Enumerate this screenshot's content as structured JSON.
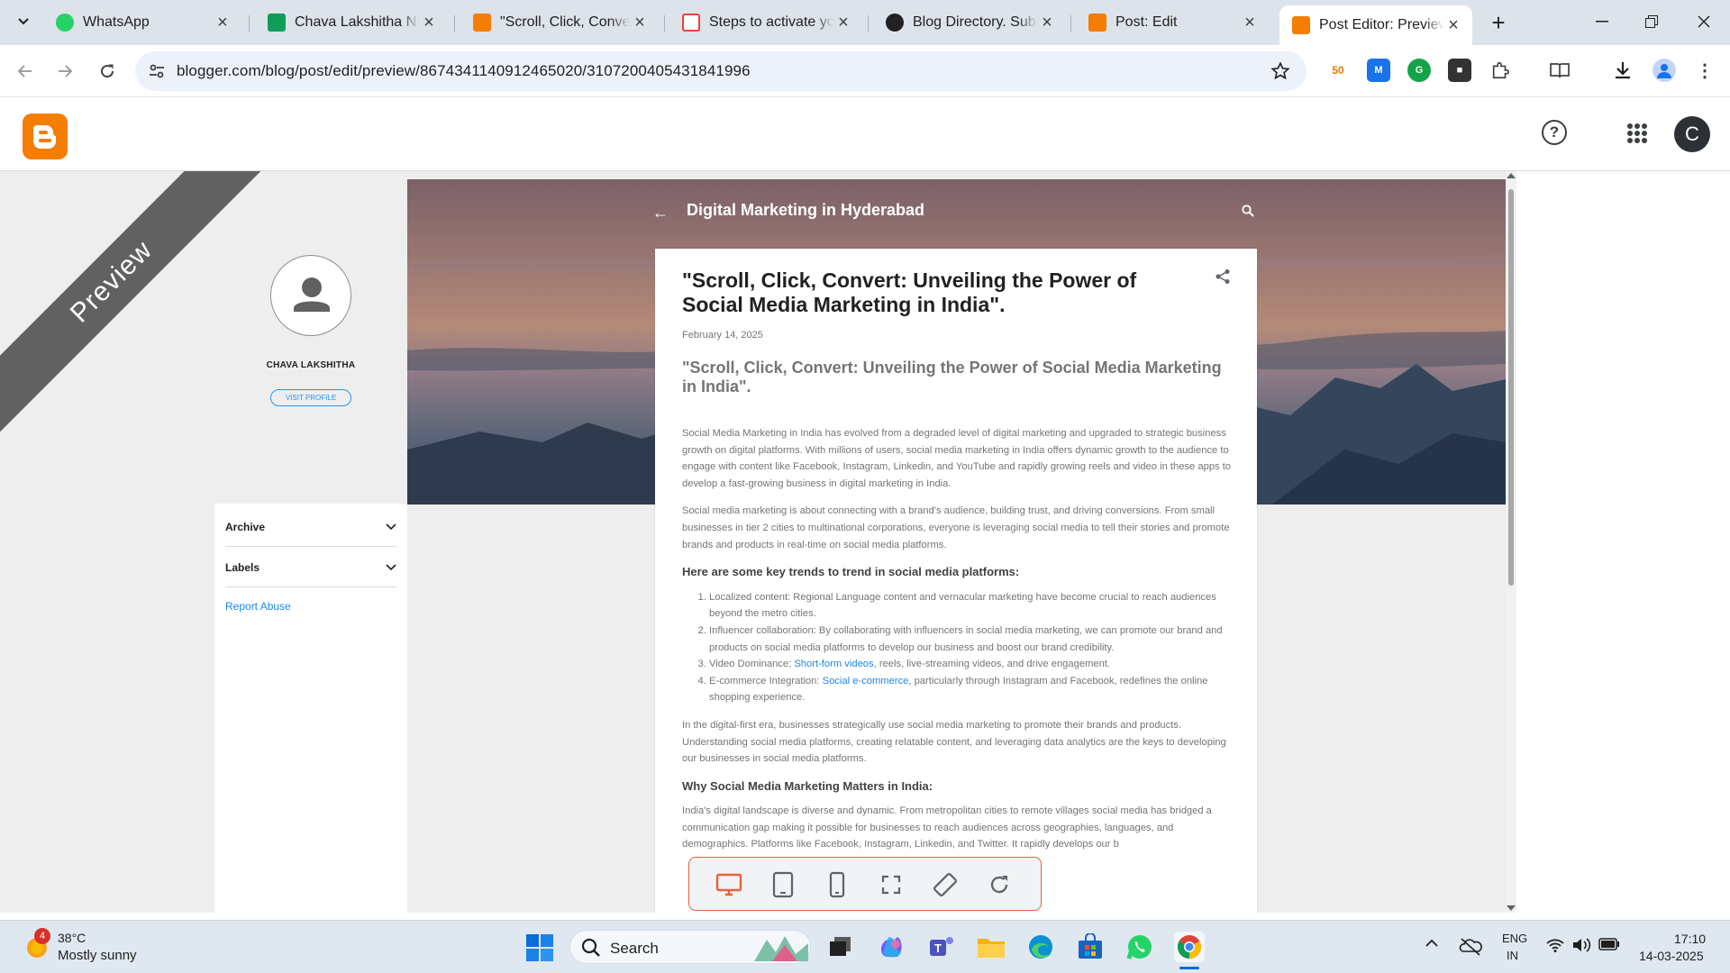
{
  "browser": {
    "tabs": [
      {
        "title": "WhatsApp",
        "icon": "whatsapp-icon"
      },
      {
        "title": "Chava Lakshitha NIDM",
        "icon": "google-sheets-icon"
      },
      {
        "title": "\"Scroll, Click, Convert",
        "icon": "blogger-icon"
      },
      {
        "title": "Steps to activate your",
        "icon": "gmail-icon"
      },
      {
        "title": "Blog Directory. Submit",
        "icon": "blog-directory-icon"
      },
      {
        "title": "Post: Edit",
        "icon": "blogger-icon"
      },
      {
        "title": "Post Editor: Preview",
        "icon": "blogger-icon",
        "active": true
      }
    ],
    "url": "blogger.com/blog/post/edit/preview/8674341140912465020/3107200405431841996"
  },
  "sidebar": {
    "author": "CHAVA LAKSHITHA",
    "visit_profile": "VISIT PROFILE",
    "archive": "Archive",
    "labels": "Labels",
    "report_abuse": "Report Abuse"
  },
  "ribbon": "Preview",
  "blog": {
    "title": "Digital Marketing in Hyderabad"
  },
  "post": {
    "title": "\"Scroll, Click, Convert: Unveiling the Power of Social Media Marketing in India\".",
    "date": "February 14, 2025",
    "subtitle": "\"Scroll, Click, Convert: Unveiling the Power of Social Media Marketing in India\".",
    "p1": "Social Media Marketing in India has evolved from a degraded level of digital marketing and upgraded to strategic business growth on digital platforms. With millions of users, social media marketing in India offers dynamic growth to the audience to engage with content like Facebook, Instagram, Linkedin, and YouTube and rapidly growing reels and video in these apps to develop a fast-growing business in digital marketing in India.",
    "p2": "Social media marketing is about connecting with a brand's audience, building trust, and driving conversions. From small businesses in tier 2 cities to multinational corporations, everyone is leveraging social media to tell their stories and promote brands and products in real-time on social media platforms.",
    "h1": "Here are some key trends to trend in social media platforms:",
    "li1": "Localized content: Regional Language content and vernacular marketing have become crucial to reach audiences beyond the metro cities.",
    "li2": "Influencer collaboration: By collaborating with influencers in social media marketing, we can promote our brand and products on social media platforms to develop our business and boost our brand credibility.",
    "li3_pre": "Video Dominance: ",
    "li3_link": "Short-form videos",
    "li3_post": ", reels, live-streaming videos, and drive engagement.",
    "li4_pre": "E-commerce Integration: ",
    "li4_link": "Social e-commerce",
    "li4_post": ", particularly through Instagram and Facebook, redefines the online shopping experience.",
    "p3": "In the digital-first era, businesses strategically use social media marketing to promote their brands and products. Understanding social media platforms, creating relatable content, and leveraging data analytics are the keys to developing our businesses in social media platforms.",
    "h2": "Why Social Media Marketing Matters in India:",
    "p4": "India's digital landscape is diverse and dynamic. From metropolitan cities to remote villages social media has bridged a communication gap making it possible for businesses to reach audiences across geographies, languages, and demographics. Platforms like Facebook, Instagram, Linkedin, and Twitter. It rapidly develops our b"
  },
  "device_toolbar": [
    "desktop-icon",
    "tablet-icon",
    "mobile-icon",
    "fullscreen-icon",
    "rotate-icon",
    "refresh-icon"
  ],
  "taskbar": {
    "weather_badge": "4",
    "temperature": "38°C",
    "weather": "Mostly sunny",
    "search": "Search",
    "lang1": "ENG",
    "lang2": "IN",
    "time": "17:10",
    "date": "14-03-2025"
  },
  "colors": {
    "blogger_orange": "#f57d00",
    "link_blue": "#1e88e5",
    "device_bar_border": "#e8623b"
  }
}
